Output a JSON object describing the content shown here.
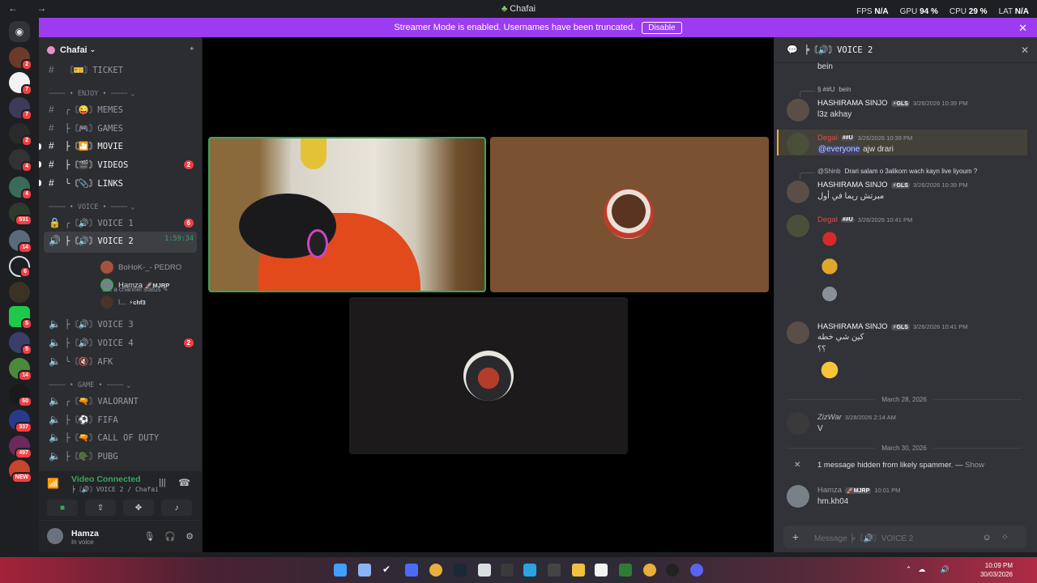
{
  "titlebar": {
    "title": "Chafai",
    "nav": "← →",
    "fps_label": "FPS",
    "fps": "N/A",
    "gpu_label": "GPU",
    "gpu": "94 %",
    "cpu_label": "CPU",
    "cpu": "29 %",
    "lat_label": "LAT",
    "lat": "N/A"
  },
  "banner": {
    "text": "Streamer Mode is enabled. Usernames have been truncated.",
    "button": "Disable"
  },
  "guilds": {
    "badges": [
      "2",
      "7",
      "7",
      "2",
      "4",
      "4",
      "531",
      "14",
      "6",
      "5",
      "5",
      "14",
      "60",
      "337",
      "497",
      "NEW"
    ]
  },
  "server": {
    "name": "Chafai"
  },
  "channels": {
    "ticket": "〘🎫〙TICKET",
    "cat_enjoy": "╌╌╌╌ • ENJOY • ╌╌╌╌",
    "memes": "╭〘😜〙MEMES",
    "games": "├〘🎮〙GAMES",
    "movie": "├〘🎦〙MOVIE",
    "videos": "├〘🎬〙VIDEOS",
    "videos_count": "2",
    "links": "╰〘📎〙LINKS",
    "cat_voice": "╌╌╌╌ • VOICE • ╌╌╌╌",
    "voice1": "╭〘🔊〙VOICE 1",
    "voice1_count": "6",
    "voice2": "├〘🔊〙VOICE 2",
    "voice2_timer": "1:59:34",
    "voice2_status": "Set a channel status ✎",
    "voice3": "├〘🔊〙VOICE 3",
    "voice4": "├〘🔊〙VOICE 4",
    "voice4_count": "2",
    "afk": "╰〘🔇〙AFK",
    "cat_game": "╌╌╌╌ • GAME • ╌╌╌╌",
    "valorant": "╭〘🔫〙VALORANT",
    "fifa": "├〘⚽〙FIFA",
    "cod": "├〘🔫〙CALL OF DUTY",
    "pubg": "├〘🪖〙PUBG"
  },
  "voice_users": [
    {
      "name": "BoHoK-_- PEDRO",
      "tag": ""
    },
    {
      "name": "Hamza",
      "tag": "🚀MJRP"
    },
    {
      "name": "l...",
      "tag": "⚡chf3"
    }
  ],
  "voice_panel": {
    "title": "Video Connected",
    "sub": "╞〘🔊〙VOICE 2 / Chafai"
  },
  "user_panel": {
    "name": "Hamza",
    "status": "In voice"
  },
  "chat": {
    "header": "╞〘🔊〙VOICE 2",
    "m0_text": "bein",
    "r1_name": "§ ##U",
    "r1_text": "bein",
    "m1_name": "HASHIRAMA SINJO",
    "m1_tag": "⚡GLS",
    "m1_ts": "3/26/2026 10:39 PM",
    "m1_text": "l3z akhay",
    "m2_name": "Degal",
    "m2_tag": "##U",
    "m2_ts": "3/26/2026 10:39 PM",
    "m2_mention": "@everyone",
    "m2_text": " ajw drari",
    "r3_name": "@Shinb",
    "r3_text": "Drari salam o 3alikom wach kayn live liyoum ?",
    "m3_name": "HASHIRAMA SINJO",
    "m3_tag": "⚡GLS",
    "m3_ts": "3/26/2026 10:39 PM",
    "m3_text": "مبرتش ريما في أول",
    "m4_name": "Degal",
    "m4_tag": "##U",
    "m4_ts": "3/26/2026 10:41 PM",
    "m5_name": "HASHIRAMA SINJO",
    "m5_tag": "⚡GLS",
    "m5_ts": "3/26/2026 10:41 PM",
    "m5_text": "كين شي خطه",
    "m5_text2": "؟؟",
    "date1": "March 28, 2026",
    "m6_name": "ZizWar",
    "m6_ts": "3/28/2026 2:14 AM",
    "m6_text": "V",
    "date2": "March 30, 2026",
    "hidden_text": "1 message hidden from likely spammer. —",
    "hidden_show": "Show",
    "m7_name": "Hamza",
    "m7_tag": "🚀MJRP",
    "m7_ts": "10:01 PM",
    "m7_text": "hm.kh04",
    "input_placeholder": "Message ╞〘🔊〙VOICE 2"
  },
  "taskbar": {
    "time": "10:09 PM",
    "date": "30/03/2026"
  },
  "colors": {
    "blurple": "#5865f2",
    "banner": "#9b3cf0",
    "green": "#3ba55c",
    "red": "#f23f43"
  }
}
